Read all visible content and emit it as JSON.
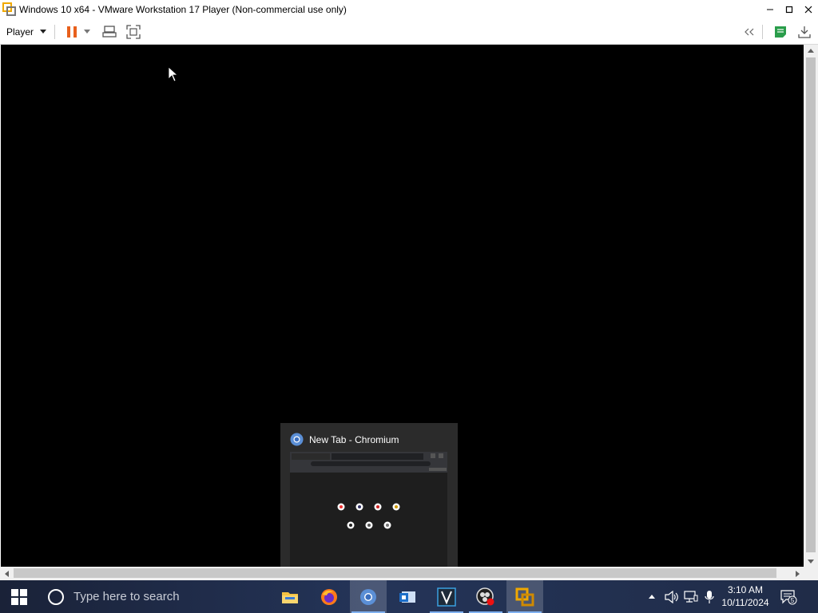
{
  "window": {
    "title": "Windows 10 x64 - VMware Workstation 17 Player (Non-commercial use only)"
  },
  "toolbar": {
    "player_label": "Player"
  },
  "thumbnail_popup": {
    "title": "New Tab - Chromium"
  },
  "taskbar": {
    "search_placeholder": "Type here to search",
    "apps": [
      "file-explorer-icon",
      "firefox-icon",
      "chromium-icon",
      "outlook-icon",
      "vscode-icon",
      "obs-icon",
      "vmware-icon"
    ],
    "active_app": "chromium-icon",
    "clock_time": "3:10 AM",
    "clock_date": "10/11/2024",
    "notification_count": "5"
  },
  "colors": {
    "accent": "#e8601c",
    "taskbar": "#1f2a44"
  }
}
